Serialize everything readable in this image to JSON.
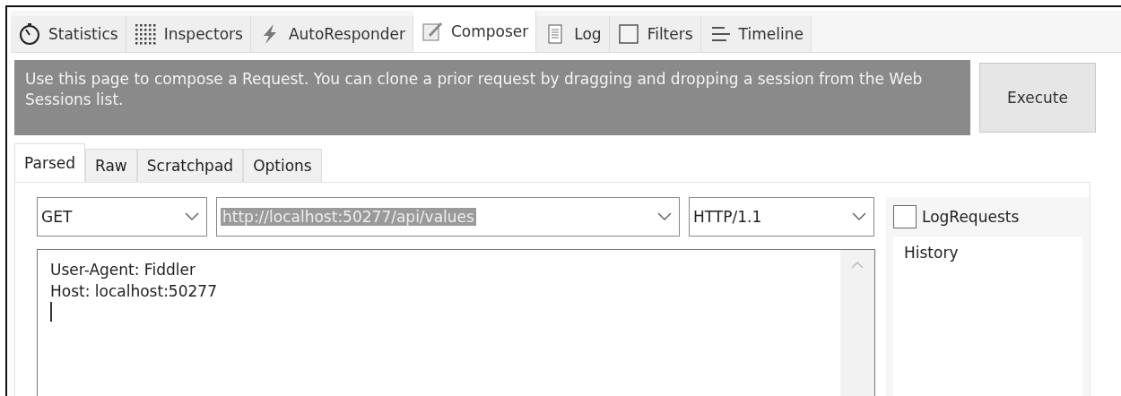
{
  "tabs": [
    {
      "label": "Statistics",
      "kind": "stopwatch",
      "selected": false
    },
    {
      "label": "Inspectors",
      "kind": "inspect",
      "selected": false
    },
    {
      "label": "AutoResponder",
      "kind": "bolt",
      "selected": false
    },
    {
      "label": "Composer",
      "kind": "compose",
      "selected": true
    },
    {
      "label": "Log",
      "kind": "log",
      "selected": false
    },
    {
      "label": "Filters",
      "kind": "filter",
      "selected": false
    },
    {
      "label": "Timeline",
      "kind": "timeline",
      "selected": false
    }
  ],
  "banner": {
    "text": "Use this page to compose a Request. You can clone a prior request by dragging and dropping a session from the Web Sessions list."
  },
  "execute_button": "Execute",
  "subtabs": [
    {
      "label": "Parsed",
      "selected": true
    },
    {
      "label": "Raw",
      "selected": false
    },
    {
      "label": "Scratchpad",
      "selected": false
    },
    {
      "label": "Options",
      "selected": false
    }
  ],
  "method": "GET",
  "url": {
    "value": "http://localhost:50277/api/values",
    "highlighted": true
  },
  "version": "HTTP/1.1",
  "log_requests": {
    "label": "LogRequests",
    "checked": false
  },
  "history_label": "History",
  "headers": [
    "User-Agent: Fiddler",
    "Host: localhost:50277"
  ]
}
